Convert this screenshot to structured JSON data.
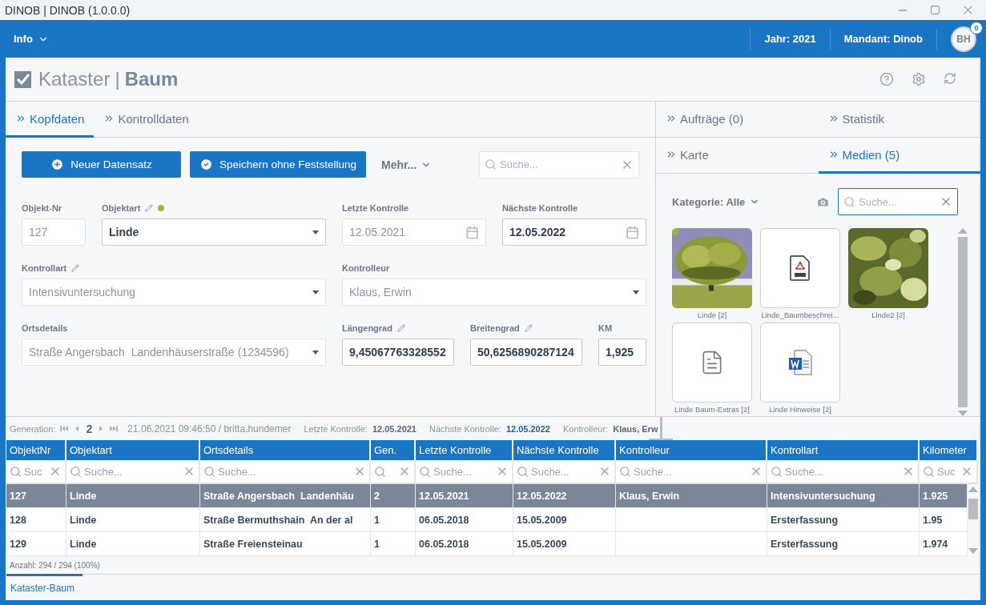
{
  "window": {
    "title": "DINOB | DINOB (1.0.0.0)"
  },
  "app_bar": {
    "menu": "Info",
    "year": "Jahr: 2021",
    "tenant": "Mandant: Dinob",
    "avatar": "BH",
    "notifications": "0"
  },
  "page": {
    "title": "Kataster",
    "separator": "|",
    "subtitle": "Baum"
  },
  "left_tabs": [
    {
      "label": "Kopfdaten",
      "selected": true
    },
    {
      "label": "Kontrolldaten",
      "selected": false
    }
  ],
  "actions": {
    "new_record": "Neuer Datensatz",
    "save": "Speichern ohne Feststellung",
    "more": "Mehr...",
    "search_placeholder": "Suche..."
  },
  "form_rows": [
    {
      "fields": [
        {
          "label": "Objekt-Nr",
          "value": "127",
          "kind": "text",
          "disabled": true,
          "pencil": false
        },
        {
          "label": "Objektart",
          "value": "Linde",
          "kind": "select",
          "disabled": false,
          "pencil": true,
          "color": "#a9b13b"
        },
        {
          "label": "Letzte Kontrolle",
          "value": "12.05.2021",
          "kind": "date",
          "disabled": true,
          "pencil": false
        },
        {
          "label": "Nächste Kontrolle",
          "value": "12.05.2022",
          "kind": "date",
          "disabled": false,
          "pencil": false
        }
      ]
    },
    {
      "fields": [
        {
          "label": "Kontrollart",
          "value": "Intensivuntersuchung",
          "kind": "select",
          "disabled": true,
          "pencil": true
        },
        {
          "label": "Kontrolleur",
          "value": "Klaus, Erwin",
          "kind": "select",
          "disabled": true,
          "pencil": false
        }
      ]
    },
    {
      "fields": [
        {
          "label": "Ortsdetails",
          "value": "Straße Angersbach  Landenhäuserstraße (1234596)",
          "kind": "select",
          "disabled": true,
          "pencil": false
        },
        {
          "label": "Längengrad",
          "value": "9,45067763328552",
          "kind": "text",
          "disabled": false,
          "pencil": true
        },
        {
          "label": "Breitengrad",
          "value": "50,6256890287124",
          "kind": "text",
          "disabled": false,
          "pencil": true
        },
        {
          "label": "KM",
          "value": "1,925",
          "kind": "text",
          "disabled": false,
          "pencil": false
        }
      ]
    }
  ],
  "right_tabs": [
    [
      {
        "label": "Aufträge (0)",
        "selected": false
      },
      {
        "label": "Statistik",
        "selected": false
      }
    ],
    [
      {
        "label": "Karte",
        "selected": false
      },
      {
        "label": "Medien (5)",
        "selected": true
      }
    ]
  ],
  "media": {
    "category": "Kategorie: Alle",
    "search_placeholder": "Suche...",
    "items": [
      {
        "label": "Linde [2]",
        "starred": true
      },
      {
        "label": "Linde_Baumbeschrei...",
        "kind": "pdf",
        "starred": false
      },
      {
        "label": "Linde2 [2]",
        "starred": false
      },
      {
        "label": "Linde Baum-Extras [2]",
        "kind": "text",
        "starred": false
      },
      {
        "label": "Linde Hinweise [2]",
        "kind": "word",
        "starred": false
      }
    ]
  },
  "info_bar": {
    "generation_label": "Generation:",
    "generation": "2",
    "stamp": "21.06.2021 09:46:50 / britta.hundemer",
    "items": [
      {
        "label": "Letzte Kontrolle:",
        "value": "12.05.2021",
        "highlighted": false
      },
      {
        "label": "Nächste Kontrolle:",
        "value": "12.05.2022",
        "highlighted": true
      },
      {
        "label": "Kontrolleur:",
        "value": "Klaus, Erw",
        "highlighted": false
      }
    ]
  },
  "table": {
    "columns": [
      {
        "label": "ObjektNr",
        "placeholder": "Suc"
      },
      {
        "label": "Objektart",
        "placeholder": "Suche..."
      },
      {
        "label": "Ortsdetails",
        "placeholder": "Suche..."
      },
      {
        "label": "Gen."
      },
      {
        "label": "Letzte Kontrolle",
        "placeholder": "Suche..."
      },
      {
        "label": "Nächste Kontrolle",
        "placeholder": "Suche..."
      },
      {
        "label": "Kontrolleur",
        "placeholder": "Suche..."
      },
      {
        "label": "Kontrollart",
        "placeholder": "Suche..."
      },
      {
        "label": "Kilometer",
        "placeholder": "Suc"
      }
    ],
    "rows": [
      {
        "selected": true,
        "cells": [
          "127",
          "Linde",
          "Straße Angersbach  Landenhäu",
          "2",
          "12.05.2021",
          "12.05.2022",
          "Klaus, Erwin",
          "Intensivuntersuchung",
          "1.925"
        ]
      },
      {
        "selected": false,
        "cells": [
          "128",
          "Linde",
          "Straße Bermuthshain  An der al",
          "1",
          "06.05.2018",
          "15.05.2009",
          "",
          "Ersterfassung",
          "1.95"
        ]
      },
      {
        "selected": false,
        "cells": [
          "129",
          "Linde",
          "Straße Freiensteinau",
          "1",
          "06.05.2018",
          "15.05.2009",
          "",
          "Ersterfassung",
          "1.974"
        ]
      }
    ],
    "count": "Anzahl: 294 / 294 (100%)"
  },
  "bottom_tabs": [
    {
      "label": "Kataster-Baum",
      "selected": true
    }
  ]
}
